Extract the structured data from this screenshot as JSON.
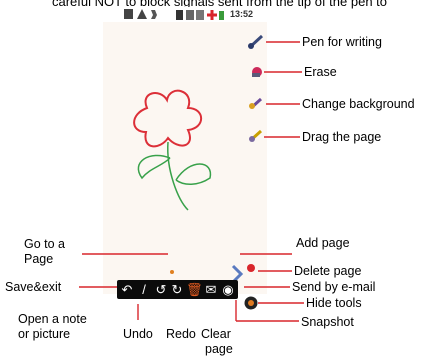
{
  "top_text": "careful NOT to block signals sent from the tip of the pen to",
  "status_bar": {
    "time": "13:52"
  },
  "labels": {
    "pen": "Pen for writing",
    "erase": "Erase",
    "change_background": "Change background",
    "drag_page": "Drag the page",
    "add_page": "Add page",
    "delete_page": "Delete page",
    "send_email": "Send by e-mail",
    "hide_tools": "Hide tools",
    "snapshot": "Snapshot",
    "go_to_page_1": "Go to a",
    "go_to_page_2": "Page",
    "save_exit": "Save&exit",
    "open_note_1": "Open a note",
    "open_note_2": "or picture",
    "undo": "Undo",
    "redo": "Redo",
    "clear_1": "Clear",
    "clear_2": "page"
  },
  "icons": {
    "status": [
      "notification-icon",
      "warning-icon",
      "usb-icon",
      "battery-icon",
      "signal-icon",
      "wifi-icon",
      "plus-icon"
    ],
    "side": [
      "pen-icon",
      "eraser-icon",
      "background-icon",
      "drag-icon"
    ],
    "toolbar": [
      "back-icon",
      "pen-icon",
      "undo-icon",
      "redo-icon",
      "trash-icon",
      "envelope-icon",
      "camera-icon"
    ]
  },
  "toolbar_glyphs": [
    "↶",
    "/",
    "↺",
    "↻",
    "🗑",
    "✉",
    "◉"
  ],
  "colors": {
    "flower": "#dc2f38",
    "stem": "#38a14a",
    "toolbar": "#0b0b0b",
    "screen": "#fcf7f2",
    "accent": "#d9262c"
  }
}
